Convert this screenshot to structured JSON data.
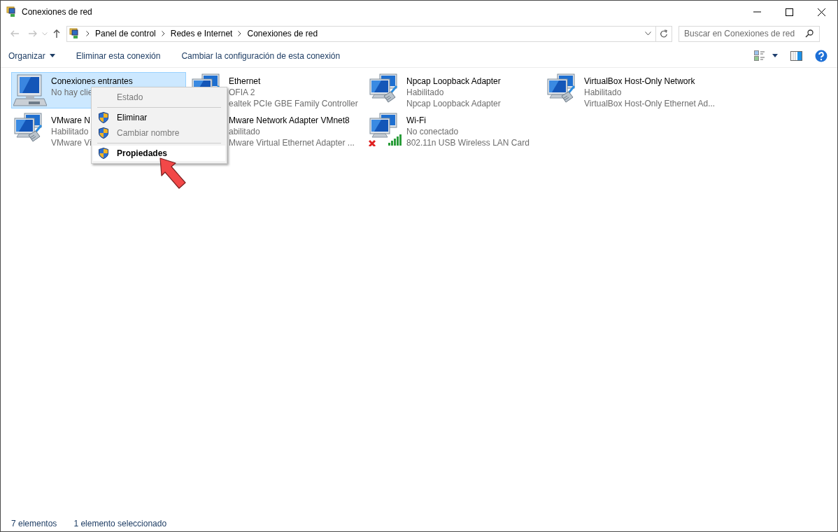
{
  "window": {
    "title": "Conexiones de red"
  },
  "address_bar": {
    "crumbs": [
      "Panel de control",
      "Redes e Internet",
      "Conexiones de red"
    ]
  },
  "search": {
    "placeholder": "Buscar en Conexiones de red"
  },
  "toolbar": {
    "commands": [
      {
        "label": "Organizar",
        "dropdown": true
      },
      {
        "label": "Eliminar esta conexión",
        "dropdown": false
      },
      {
        "label": "Cambiar la configuración de esta conexión",
        "dropdown": false
      }
    ]
  },
  "items": [
    {
      "kind": "computer",
      "name": "Conexiones entrantes",
      "status": "No hay clie",
      "selected": true
    },
    {
      "kind": "adapter",
      "name": "Ethernet",
      "status": "OFIA 2",
      "device": "ealtek PCIe GBE Family Controller",
      "selected": false
    },
    {
      "kind": "adapter",
      "name": "Npcap Loopback Adapter",
      "status": "Habilitado",
      "device": "Npcap Loopback Adapter",
      "selected": false
    },
    {
      "kind": "adapter",
      "name": "VirtualBox Host-Only Network",
      "status": "Habilitado",
      "device": "VirtualBox Host-Only Ethernet Ad...",
      "selected": false
    },
    {
      "kind": "adapter",
      "name": "VMware N",
      "status": "Habilitado",
      "device": "VMware Vi",
      "selected": false
    },
    {
      "kind": "adapter",
      "name": "Mware Network Adapter VMnet8",
      "status": "abilitado",
      "device": "Mware Virtual Ethernet Adapter ...",
      "selected": false
    },
    {
      "kind": "wifi",
      "name": "Wi-Fi",
      "status": "No conectado",
      "device": "802.11n USB Wireless LAN Card",
      "selected": false
    }
  ],
  "context_menu": [
    {
      "kind": "item",
      "label": "Estado",
      "disabled": true,
      "shield": false,
      "bold": false,
      "highlighted": false
    },
    {
      "kind": "separator"
    },
    {
      "kind": "item",
      "label": "Eliminar",
      "disabled": false,
      "shield": true,
      "bold": false,
      "highlighted": false
    },
    {
      "kind": "item",
      "label": "Cambiar nombre",
      "disabled": true,
      "shield": true,
      "bold": false,
      "highlighted": false
    },
    {
      "kind": "separator"
    },
    {
      "kind": "item",
      "label": "Propiedades",
      "disabled": false,
      "shield": true,
      "bold": true,
      "highlighted": true
    }
  ],
  "status_bar": {
    "count": "7 elementos",
    "selection": "1 elemento seleccionado"
  }
}
